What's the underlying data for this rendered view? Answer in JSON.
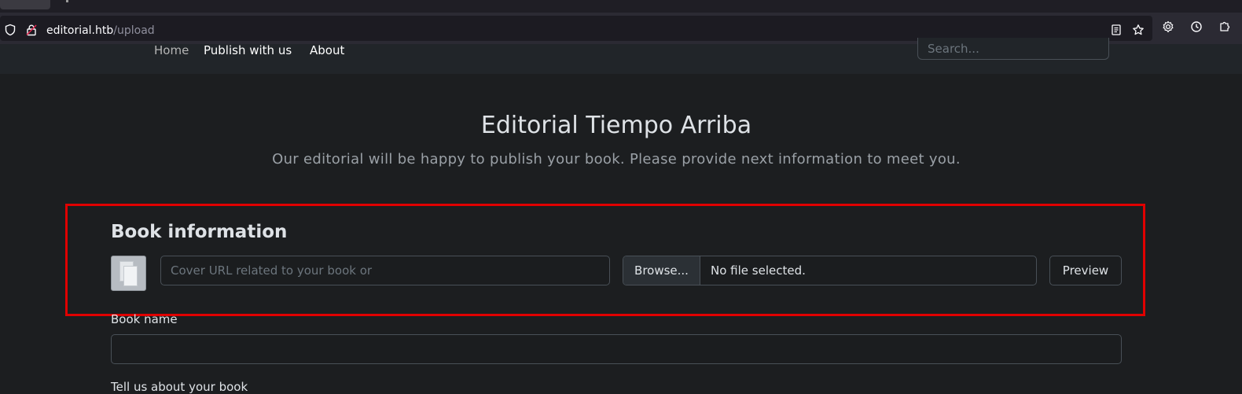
{
  "browser": {
    "url_host": "editorial.htb",
    "url_path": "/upload"
  },
  "navbar": {
    "links": [
      "Home",
      "Publish with us",
      "About"
    ],
    "search_placeholder": "Search..."
  },
  "header": {
    "title": "Editorial Tiempo Arriba",
    "subtitle": "Our editorial will be happy to publish your book. Please provide next information to meet you."
  },
  "book_info": {
    "section_title": "Book information",
    "cover_url_placeholder": "Cover URL related to your book or",
    "browse_label": "Browse...",
    "file_status": "No file selected.",
    "preview_label": "Preview"
  },
  "form": {
    "book_name_label": "Book name",
    "about_label": "Tell us about your book"
  },
  "colors": {
    "highlight": "#e00000",
    "background": "#1c1e20"
  }
}
